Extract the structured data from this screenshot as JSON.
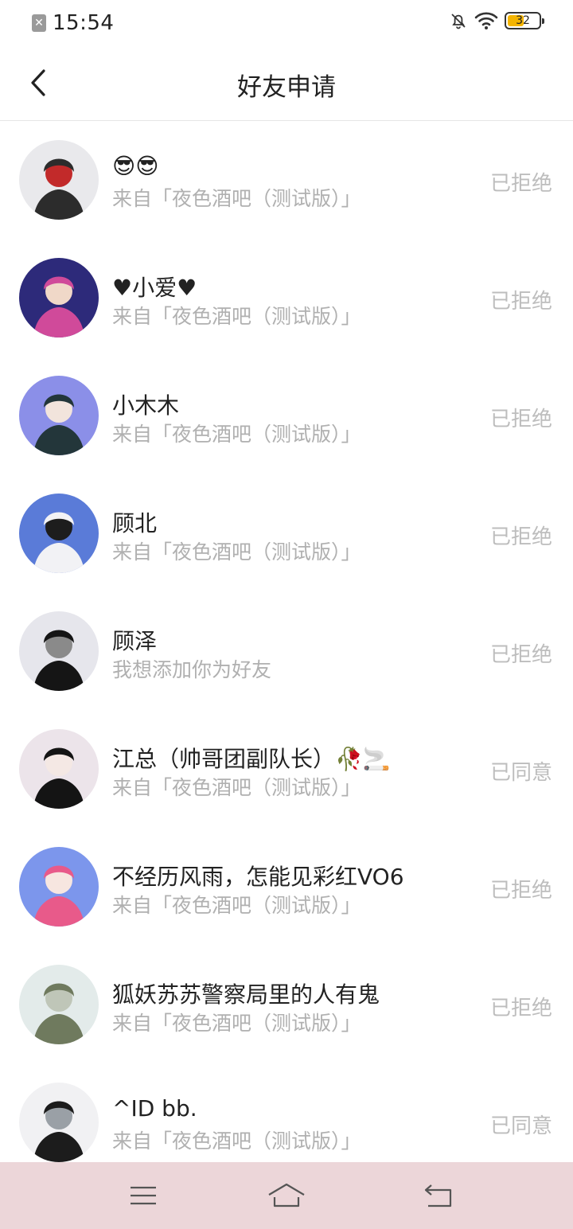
{
  "status_bar": {
    "time": "15:54",
    "battery_level": "32",
    "battery_percent": 32
  },
  "header": {
    "title": "好友申请"
  },
  "requests": [
    {
      "name": "😎😎",
      "source": "来自「夜色酒吧（测试版）」",
      "status": "已拒绝",
      "avatar_colors": [
        "#e9e9ec",
        "#2c2c2c",
        "#c22a2a"
      ]
    },
    {
      "name": "♥小爱♥",
      "source": "来自「夜色酒吧（测试版）」",
      "status": "已拒绝",
      "avatar_colors": [
        "#2d2a7a",
        "#d04a9a",
        "#f0d8c8"
      ]
    },
    {
      "name": "小木木",
      "source": "来自「夜色酒吧（测试版）」",
      "status": "已拒绝",
      "avatar_colors": [
        "#8b8fe8",
        "#23363a",
        "#f2e4dc"
      ]
    },
    {
      "name": "顾北",
      "source": "来自「夜色酒吧（测试版）」",
      "status": "已拒绝",
      "avatar_colors": [
        "#5a7bd8",
        "#f2f2f5",
        "#1d1d1d"
      ]
    },
    {
      "name": "顾泽",
      "source": "我想添加你为好友",
      "status": "已拒绝",
      "avatar_colors": [
        "#e6e6ec",
        "#151515",
        "#8a8a8a"
      ]
    },
    {
      "name": "江总（帅哥团副队长）🥀🚬",
      "source": "来自「夜色酒吧（测试版）」",
      "status": "已同意",
      "avatar_colors": [
        "#ece4ea",
        "#141414",
        "#f4e8e4"
      ]
    },
    {
      "name": "不经历风雨，怎能见彩红VO6",
      "source": "来自「夜色酒吧（测试版）」",
      "status": "已拒绝",
      "avatar_colors": [
        "#7c96ec",
        "#e85a8a",
        "#f7e6e0"
      ]
    },
    {
      "name": "狐妖苏苏警察局里的人有鬼",
      "source": "来自「夜色酒吧（测试版）」",
      "status": "已拒绝",
      "avatar_colors": [
        "#e3ebea",
        "#6f7a5e",
        "#bfc6b8"
      ]
    },
    {
      "name": "^ID  bb.",
      "source": "来自「夜色酒吧（测试版）」",
      "status": "已同意",
      "avatar_colors": [
        "#f1f1f3",
        "#1c1c1c",
        "#9aa0a6"
      ]
    }
  ]
}
